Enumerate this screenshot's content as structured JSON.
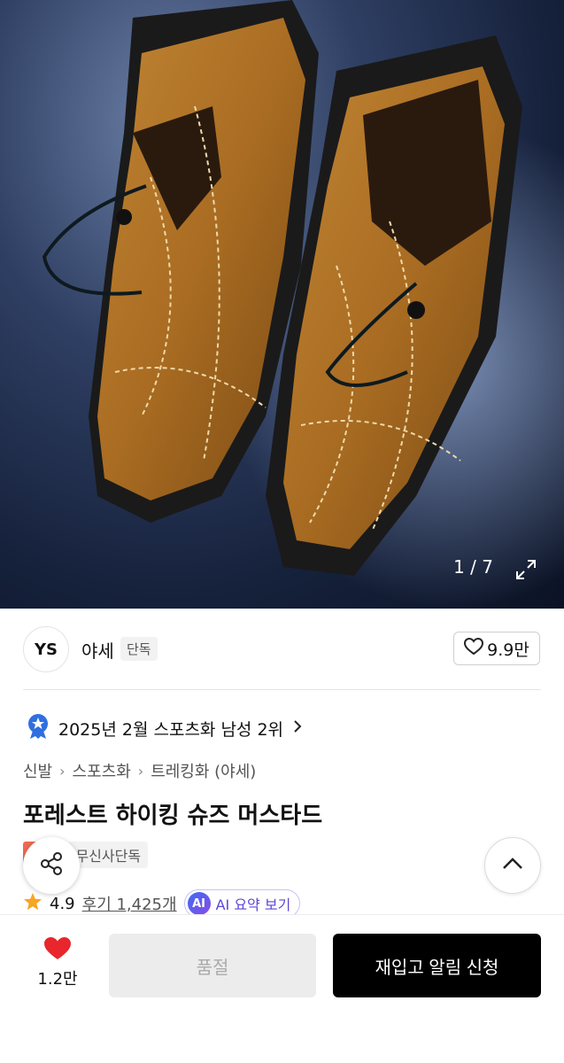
{
  "gallery": {
    "counter": "1 / 7"
  },
  "brand": {
    "logo_text": "YS",
    "name": "야세",
    "tag": "단독",
    "likes": "9.9만"
  },
  "ranking": {
    "text": "2025년 2월 스포츠화 남성 2위"
  },
  "breadcrumb": [
    "신발",
    "스포츠화",
    "트레킹화 (야세)"
  ],
  "product": {
    "title": "포레스트 하이킹 슈즈 머스타드"
  },
  "badges": {
    "sale": "세일",
    "exclusive": "무신사단독"
  },
  "review": {
    "rating": "4.9",
    "review_link": "후기 1,425개",
    "ai_chip": "AI",
    "ai_label": "AI 요약 보기"
  },
  "bottom": {
    "wish_count": "1.2만",
    "soldout_label": "품절",
    "restock_label": "재입고 알림 신청"
  },
  "colors": {
    "heart": "#e8262c",
    "star": "#f5a623",
    "sale_badge": "#ef6a52",
    "ai_accent": "#5b47d6"
  }
}
